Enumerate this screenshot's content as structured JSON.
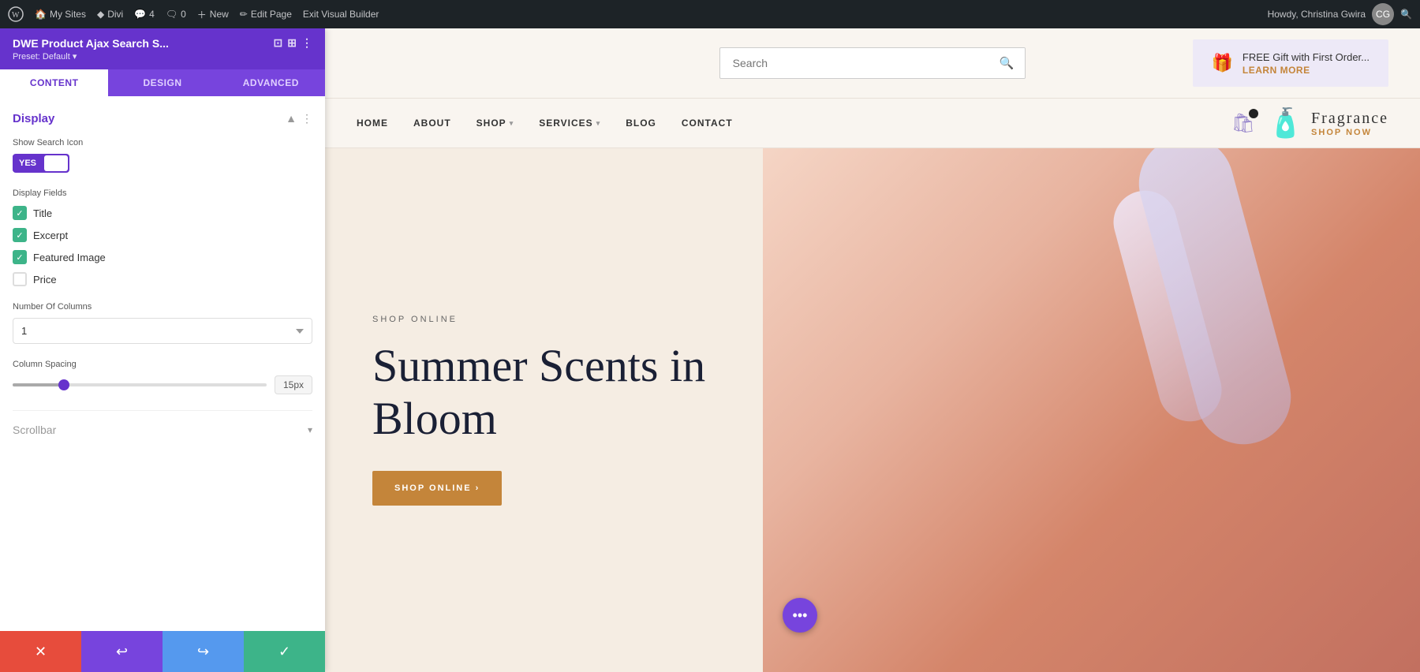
{
  "admin_bar": {
    "wp_label": "WordPress",
    "my_sites": "My Sites",
    "divi": "Divi",
    "comments_count": "4",
    "comments_label": "4",
    "pending_comments": "0",
    "new_label": "New",
    "edit_page_label": "Edit Page",
    "exit_builder_label": "Exit Visual Builder",
    "howdy": "Howdy, Christina Gwira"
  },
  "panel": {
    "title": "DWE Product Ajax Search S...",
    "preset": "Preset: Default",
    "tabs": [
      {
        "id": "content",
        "label": "Content",
        "active": true
      },
      {
        "id": "design",
        "label": "Design",
        "active": false
      },
      {
        "id": "advanced",
        "label": "Advanced",
        "active": false
      }
    ],
    "display_section": {
      "title": "Display",
      "show_search_icon_label": "Show Search Icon",
      "toggle_yes": "YES",
      "display_fields_label": "Display Fields",
      "fields": [
        {
          "id": "title",
          "label": "Title",
          "checked": true
        },
        {
          "id": "excerpt",
          "label": "Excerpt",
          "checked": true
        },
        {
          "id": "featured_image",
          "label": "Featured Image",
          "checked": true
        },
        {
          "id": "price",
          "label": "Price",
          "checked": false
        }
      ],
      "number_of_columns_label": "Number Of Columns",
      "columns_value": "1",
      "column_spacing_label": "Column Spacing",
      "column_spacing_value": "15px"
    },
    "scrollbar_section": {
      "title": "Scrollbar"
    },
    "toolbar": {
      "cancel_label": "✕",
      "undo_label": "↩",
      "redo_label": "↪",
      "confirm_label": "✓"
    }
  },
  "site": {
    "search_placeholder": "Search",
    "promo": {
      "text": "FREE Gift with First Order...",
      "link": "LEARN MORE"
    },
    "nav": {
      "links": [
        {
          "label": "HOME",
          "has_dropdown": false
        },
        {
          "label": "ABOUT",
          "has_dropdown": false
        },
        {
          "label": "SHOP",
          "has_dropdown": true
        },
        {
          "label": "SERVICES",
          "has_dropdown": true
        },
        {
          "label": "BLOG",
          "has_dropdown": false
        },
        {
          "label": "CONTACT",
          "has_dropdown": false
        }
      ]
    },
    "fragrance": {
      "name": "Fragrance",
      "cta": "SHOP NOW"
    },
    "hero": {
      "subtitle": "SHOP ONLINE",
      "title": "Summer Scents in Bloom",
      "button": "SHOP ONLINE ›"
    }
  }
}
